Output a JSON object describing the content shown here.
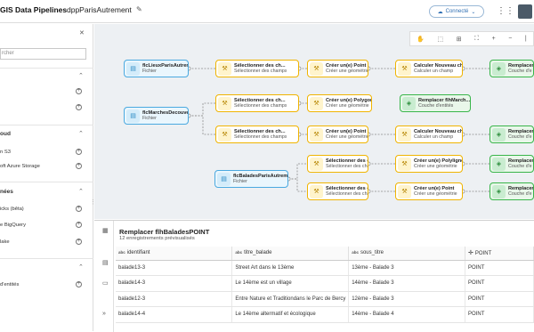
{
  "header": {
    "app_name": "GIS Data Pipelines",
    "project_name": "dppParisAutrement",
    "status": "Connecté"
  },
  "left_panel": {
    "search_placeholder": "rcher",
    "sections": [
      {
        "title": "",
        "items": [
          "",
          ""
        ]
      },
      {
        "title": "oud",
        "items": [
          "n S3",
          "oft Azure Storage"
        ]
      },
      {
        "title": "nées",
        "items": [
          "icks (bêta)",
          "e BigQuery",
          "lake"
        ]
      },
      {
        "title": "",
        "items": [
          "d'entités"
        ]
      }
    ]
  },
  "nodes": {
    "src1": {
      "t1": "flcLieuxParisAutrem...",
      "t2": "Fichier"
    },
    "src2": {
      "t1": "flcMarchesDecouver...",
      "t2": "Fichier"
    },
    "src3": {
      "t1": "flcBaladesParisAutrem...",
      "t2": "Fichier"
    },
    "sel1": {
      "t1": "Sélectionner des ch...",
      "t2": "Sélectionner des champs"
    },
    "sel2": {
      "t1": "Sélectionner des ch...",
      "t2": "Sélectionner des champs"
    },
    "sel3": {
      "t1": "Sélectionner des ch...",
      "t2": "Sélectionner des champs"
    },
    "sel4": {
      "t1": "Sélectionner des ch...",
      "t2": "Sélectionner des champs"
    },
    "sel5": {
      "t1": "Sélectionner des ch...",
      "t2": "Sélectionner des champs"
    },
    "geo1": {
      "t1": "Créer un(e) Point",
      "t2": "Créer une géométrie"
    },
    "geo2": {
      "t1": "Créer un(e) Polygone",
      "t2": "Créer une géométrie"
    },
    "geo3": {
      "t1": "Créer un(e) Point",
      "t2": "Créer une géométrie"
    },
    "geo4": {
      "t1": "Créer un(e) Polyligne",
      "t2": "Créer une géométrie"
    },
    "geo5": {
      "t1": "Créer un(e) Point",
      "t2": "Créer une géométrie"
    },
    "calc1": {
      "t1": "Calculer Nouveau ch...",
      "t2": "Calculer un champ"
    },
    "calc2": {
      "t1": "Calculer Nouveau ch...",
      "t2": "Calculer un champ"
    },
    "out1": {
      "t1": "Remplacer ",
      "t2": "Couche d'e"
    },
    "out2": {
      "t1": "Remplacer flhMarch...",
      "t2": "Couche d'entités"
    },
    "out3": {
      "t1": "Remplacer ",
      "t2": "Couche d'e"
    },
    "out4": {
      "t1": "Remplacer ",
      "t2": "Couche d'e"
    },
    "out5": {
      "t1": "Remplacer ",
      "t2": "Couche d'e"
    }
  },
  "preview": {
    "title": "Remplacer flhBaladesPOINT",
    "subtitle": "12 enregistrements prévisualisés",
    "columns": [
      {
        "type": "abc",
        "name": "identifiant"
      },
      {
        "type": "abc",
        "name": "titre_balade"
      },
      {
        "type": "abc",
        "name": "sous_titre"
      },
      {
        "type": "geo",
        "name": "POINT"
      }
    ],
    "rows": [
      [
        "balade13-3",
        "Street Art dans le 13ème",
        "13ème - Balade 3",
        "POINT"
      ],
      [
        "balade14-3",
        "Le 14ème est un village",
        "14ème - Balade 3",
        "POINT"
      ],
      [
        "balade12-3",
        "Entre Nature et Traditiondans le Parc de Bercy",
        "12ème - Balade 3",
        "POINT"
      ],
      [
        "balade14-4",
        "Le 14ème altermatif et écologique",
        "14ème - Balade 4",
        "POINT"
      ]
    ]
  }
}
